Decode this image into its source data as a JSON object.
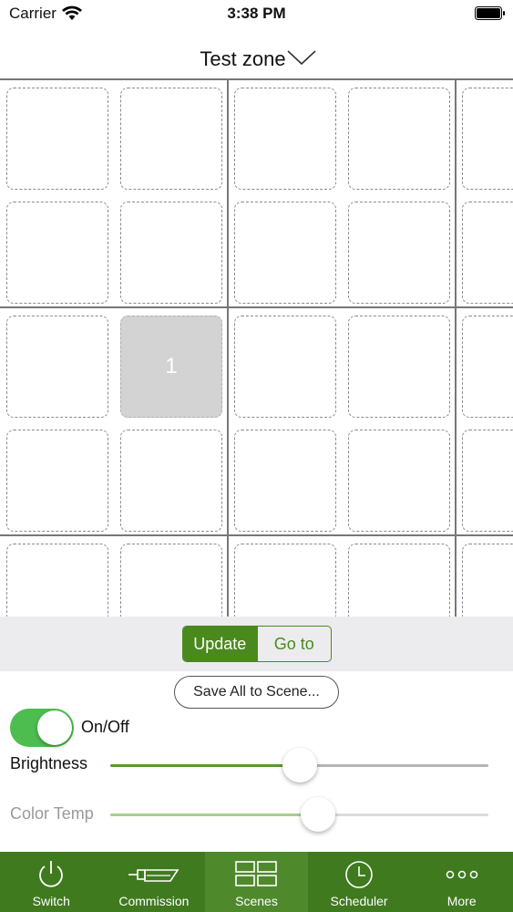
{
  "status_bar": {
    "carrier": "Carrier",
    "time": "3:38 PM"
  },
  "header": {
    "zone_title": "Test zone"
  },
  "grid": {
    "assigned_tile_label": "1"
  },
  "segment": {
    "update_label": "Update",
    "goto_label": "Go to",
    "selected": "Update"
  },
  "actions": {
    "save_all_label": "Save All to Scene..."
  },
  "controls": {
    "onoff_label": "On/Off",
    "onoff_state": true,
    "brightness_label": "Brightness",
    "brightness_value": 0.5,
    "color_temp_label": "Color Temp",
    "color_temp_value": 0.55
  },
  "tab_bar": {
    "tabs": [
      {
        "label": "Switch",
        "icon": "power-icon"
      },
      {
        "label": "Commission",
        "icon": "commission-icon"
      },
      {
        "label": "Scenes",
        "icon": "scenes-icon"
      },
      {
        "label": "Scheduler",
        "icon": "clock-icon"
      },
      {
        "label": "More",
        "icon": "more-icon"
      }
    ],
    "selected": "Scenes"
  },
  "colors": {
    "accent_green": "#4a8a1c",
    "tab_bar_green": "#3f7a1f",
    "toggle_on": "#4cbd4e"
  }
}
